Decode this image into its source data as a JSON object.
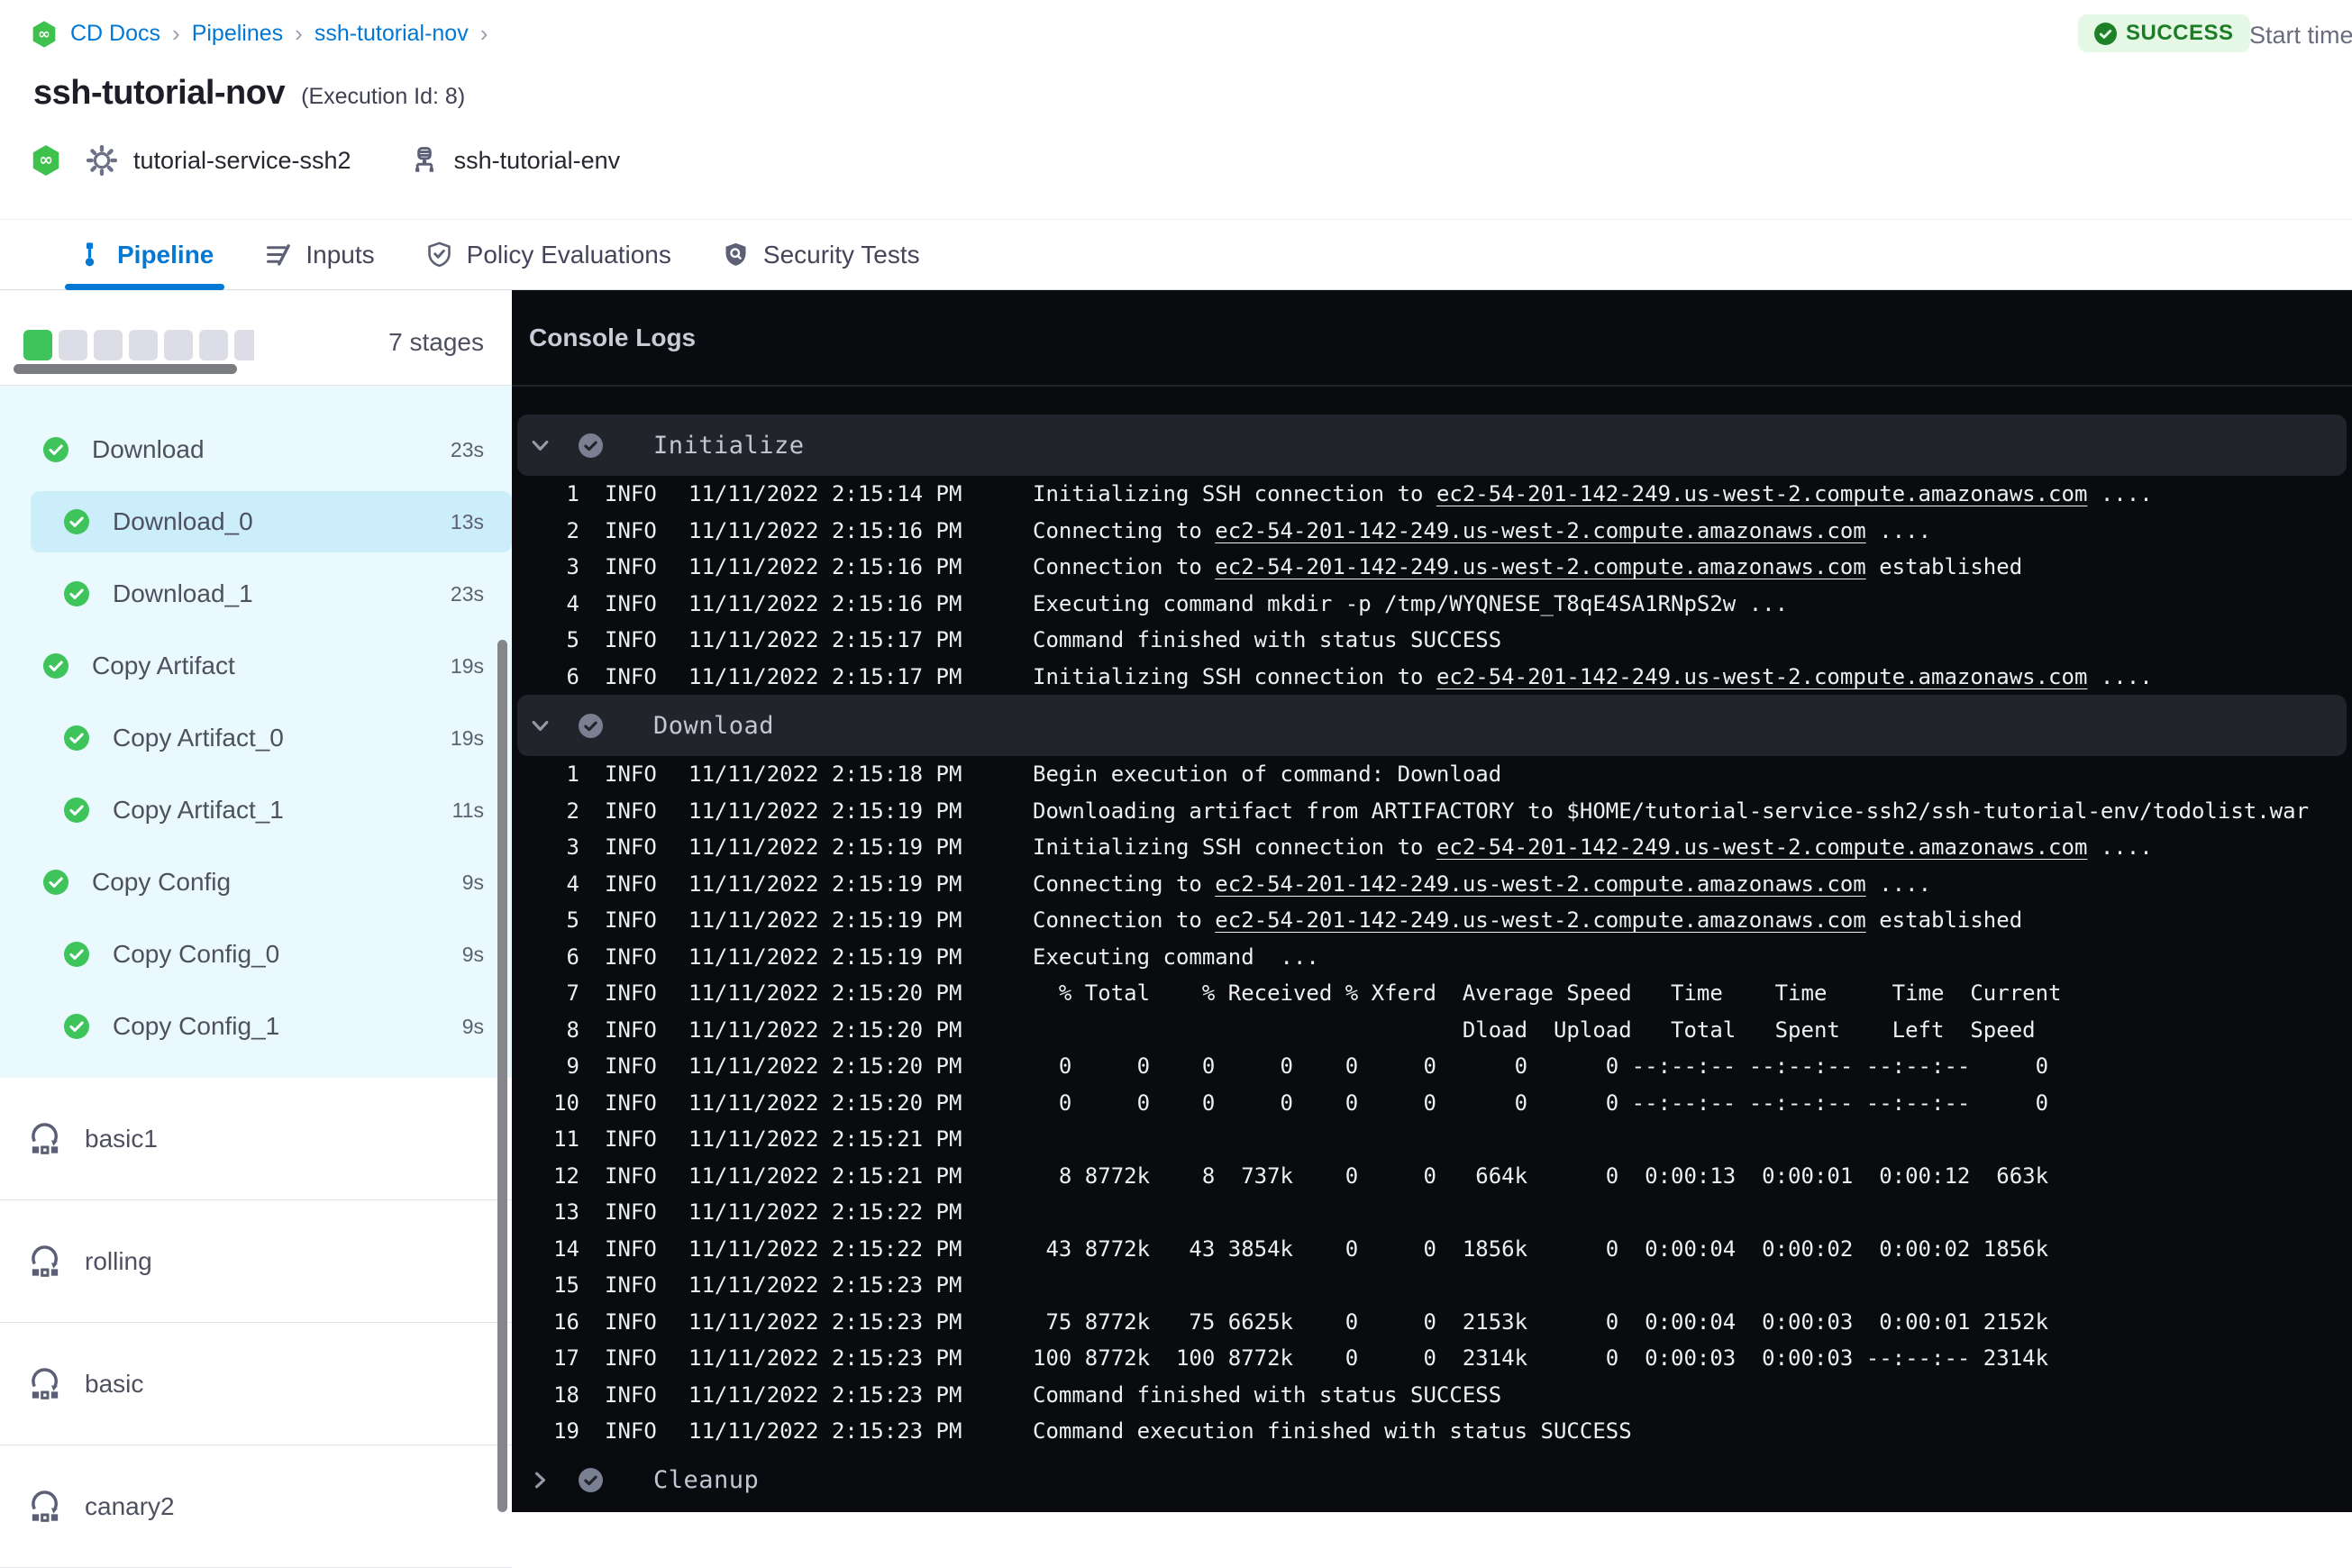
{
  "colors": {
    "accent_blue": "#0278d5",
    "success_green": "#3fc35b",
    "badge_bg": "#e4f8e5",
    "badge_text": "#1b7d24",
    "console_bg": "#0a0b0e",
    "console_panel": "#22242b",
    "sidebar_bg": "#e9f9fd",
    "sidebar_selected": "#cbeefa"
  },
  "breadcrumb": {
    "separator": "›",
    "items": [
      "CD Docs",
      "Pipelines",
      "ssh-tutorial-nov"
    ]
  },
  "status": {
    "label": "SUCCESS"
  },
  "header": {
    "title": "ssh-tutorial-nov",
    "execution_id": "(Execution Id: 8)",
    "service": "tutorial-service-ssh2",
    "environment": "ssh-tutorial-env",
    "start_time_label": "Start time"
  },
  "tabs": [
    {
      "label": "Pipeline",
      "icon": "pipeline",
      "active": true
    },
    {
      "label": "Inputs",
      "icon": "inputs",
      "active": false
    },
    {
      "label": "Policy Evaluations",
      "icon": "policy",
      "active": false
    },
    {
      "label": "Security Tests",
      "icon": "security",
      "active": false
    }
  ],
  "sidebar": {
    "stage_count_label": "7 stages",
    "progress": {
      "total": 7,
      "done": 1
    },
    "stages": [
      {
        "name": "Download",
        "duration": "23s",
        "child": false,
        "selected": false
      },
      {
        "name": "Download_0",
        "duration": "13s",
        "child": true,
        "selected": true
      },
      {
        "name": "Download_1",
        "duration": "23s",
        "child": true,
        "selected": false
      },
      {
        "name": "Copy Artifact",
        "duration": "19s",
        "child": false,
        "selected": false
      },
      {
        "name": "Copy Artifact_0",
        "duration": "19s",
        "child": true,
        "selected": false
      },
      {
        "name": "Copy Artifact_1",
        "duration": "11s",
        "child": true,
        "selected": false
      },
      {
        "name": "Copy Config",
        "duration": "9s",
        "child": false,
        "selected": false
      },
      {
        "name": "Copy Config_0",
        "duration": "9s",
        "child": true,
        "selected": false
      },
      {
        "name": "Copy Config_1",
        "duration": "9s",
        "child": true,
        "selected": false
      }
    ],
    "rollback_items": [
      "basic1",
      "rolling",
      "basic",
      "canary2"
    ]
  },
  "console": {
    "title": "Console Logs",
    "sections": [
      {
        "name": "Initialize",
        "collapsed": false,
        "lines": [
          {
            "num": 1,
            "level": "INFO",
            "time": "11/11/2022 2:15:14 PM",
            "parts": [
              {
                "t": "Initializing SSH connection to "
              },
              {
                "t": "ec2-54-201-142-249.us-west-2.compute.amazonaws.com",
                "link": true
              },
              {
                "t": " ...."
              }
            ]
          },
          {
            "num": 2,
            "level": "INFO",
            "time": "11/11/2022 2:15:16 PM",
            "parts": [
              {
                "t": "Connecting to "
              },
              {
                "t": "ec2-54-201-142-249.us-west-2.compute.amazonaws.com",
                "link": true
              },
              {
                "t": " ...."
              }
            ]
          },
          {
            "num": 3,
            "level": "INFO",
            "time": "11/11/2022 2:15:16 PM",
            "parts": [
              {
                "t": "Connection to "
              },
              {
                "t": "ec2-54-201-142-249.us-west-2.compute.amazonaws.com",
                "link": true
              },
              {
                "t": " established"
              }
            ]
          },
          {
            "num": 4,
            "level": "INFO",
            "time": "11/11/2022 2:15:16 PM",
            "parts": [
              {
                "t": "Executing command mkdir -p /tmp/WYQNESE_T8qE4SA1RNpS2w ..."
              }
            ]
          },
          {
            "num": 5,
            "level": "INFO",
            "time": "11/11/2022 2:15:17 PM",
            "parts": [
              {
                "t": "Command finished with status SUCCESS"
              }
            ]
          },
          {
            "num": 6,
            "level": "INFO",
            "time": "11/11/2022 2:15:17 PM",
            "parts": [
              {
                "t": "Initializing SSH connection to "
              },
              {
                "t": "ec2-54-201-142-249.us-west-2.compute.amazonaws.com",
                "link": true
              },
              {
                "t": " ...."
              }
            ]
          }
        ]
      },
      {
        "name": "Download",
        "collapsed": false,
        "lines": [
          {
            "num": 1,
            "level": "INFO",
            "time": "11/11/2022 2:15:18 PM",
            "parts": [
              {
                "t": "Begin execution of command: Download"
              }
            ]
          },
          {
            "num": 2,
            "level": "INFO",
            "time": "11/11/2022 2:15:19 PM",
            "parts": [
              {
                "t": "Downloading artifact from ARTIFACTORY to $HOME/tutorial-service-ssh2/ssh-tutorial-env/todolist.war"
              }
            ]
          },
          {
            "num": 3,
            "level": "INFO",
            "time": "11/11/2022 2:15:19 PM",
            "parts": [
              {
                "t": "Initializing SSH connection to "
              },
              {
                "t": "ec2-54-201-142-249.us-west-2.compute.amazonaws.com",
                "link": true
              },
              {
                "t": " ...."
              }
            ]
          },
          {
            "num": 4,
            "level": "INFO",
            "time": "11/11/2022 2:15:19 PM",
            "parts": [
              {
                "t": "Connecting to "
              },
              {
                "t": "ec2-54-201-142-249.us-west-2.compute.amazonaws.com",
                "link": true
              },
              {
                "t": " ...."
              }
            ]
          },
          {
            "num": 5,
            "level": "INFO",
            "time": "11/11/2022 2:15:19 PM",
            "parts": [
              {
                "t": "Connection to "
              },
              {
                "t": "ec2-54-201-142-249.us-west-2.compute.amazonaws.com",
                "link": true
              },
              {
                "t": " established"
              }
            ]
          },
          {
            "num": 6,
            "level": "INFO",
            "time": "11/11/2022 2:15:19 PM",
            "parts": [
              {
                "t": "Executing command  ..."
              }
            ]
          },
          {
            "num": 7,
            "level": "INFO",
            "time": "11/11/2022 2:15:20 PM",
            "parts": [
              {
                "t": "  % Total    % Received % Xferd  Average Speed   Time    Time     Time  Current"
              }
            ]
          },
          {
            "num": 8,
            "level": "INFO",
            "time": "11/11/2022 2:15:20 PM",
            "parts": [
              {
                "t": "                                 Dload  Upload   Total   Spent    Left  Speed"
              }
            ]
          },
          {
            "num": 9,
            "level": "INFO",
            "time": "11/11/2022 2:15:20 PM",
            "parts": [
              {
                "t": "  0     0    0     0    0     0      0      0 --:--:-- --:--:-- --:--:--     0"
              }
            ]
          },
          {
            "num": 10,
            "level": "INFO",
            "time": "11/11/2022 2:15:20 PM",
            "parts": [
              {
                "t": "  0     0    0     0    0     0      0      0 --:--:-- --:--:-- --:--:--     0"
              }
            ]
          },
          {
            "num": 11,
            "level": "INFO",
            "time": "11/11/2022 2:15:21 PM",
            "parts": []
          },
          {
            "num": 12,
            "level": "INFO",
            "time": "11/11/2022 2:15:21 PM",
            "parts": [
              {
                "t": "  8 8772k    8  737k    0     0   664k      0  0:00:13  0:00:01  0:00:12  663k"
              }
            ]
          },
          {
            "num": 13,
            "level": "INFO",
            "time": "11/11/2022 2:15:22 PM",
            "parts": []
          },
          {
            "num": 14,
            "level": "INFO",
            "time": "11/11/2022 2:15:22 PM",
            "parts": [
              {
                "t": " 43 8772k   43 3854k    0     0  1856k      0  0:00:04  0:00:02  0:00:02 1856k"
              }
            ]
          },
          {
            "num": 15,
            "level": "INFO",
            "time": "11/11/2022 2:15:23 PM",
            "parts": []
          },
          {
            "num": 16,
            "level": "INFO",
            "time": "11/11/2022 2:15:23 PM",
            "parts": [
              {
                "t": " 75 8772k   75 6625k    0     0  2153k      0  0:00:04  0:00:03  0:00:01 2152k"
              }
            ]
          },
          {
            "num": 17,
            "level": "INFO",
            "time": "11/11/2022 2:15:23 PM",
            "parts": [
              {
                "t": "100 8772k  100 8772k    0     0  2314k      0  0:00:03  0:00:03 --:--:-- 2314k"
              }
            ]
          },
          {
            "num": 18,
            "level": "INFO",
            "time": "11/11/2022 2:15:23 PM",
            "parts": [
              {
                "t": "Command finished with status SUCCESS"
              }
            ]
          },
          {
            "num": 19,
            "level": "INFO",
            "time": "11/11/2022 2:15:23 PM",
            "parts": [
              {
                "t": "Command execution finished with status SUCCESS"
              }
            ]
          }
        ]
      },
      {
        "name": "Cleanup",
        "collapsed": true,
        "lines": []
      }
    ]
  }
}
